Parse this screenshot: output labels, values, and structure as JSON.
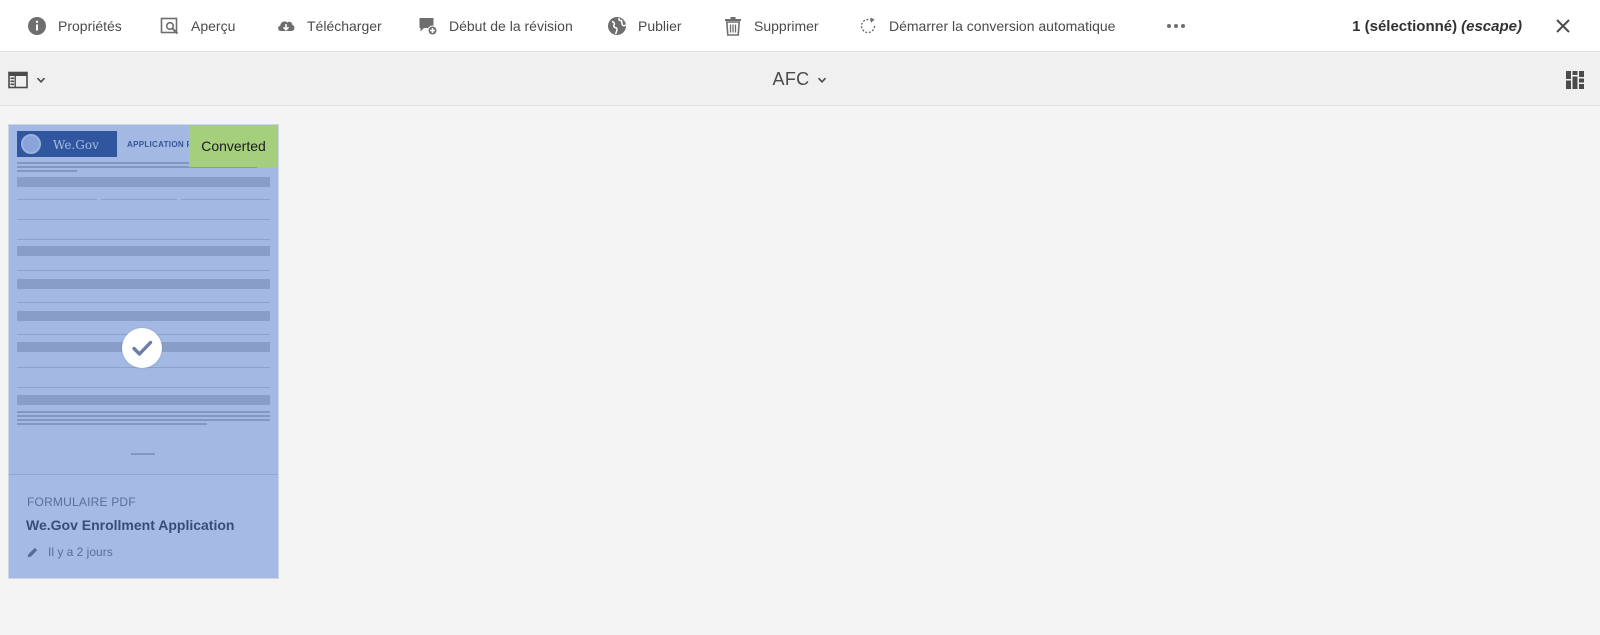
{
  "actionbar": {
    "actions": [
      {
        "id": "properties",
        "label": "Propriétés",
        "icon": "info-icon"
      },
      {
        "id": "preview",
        "label": "Aperçu",
        "icon": "preview-icon"
      },
      {
        "id": "download",
        "label": "Télécharger",
        "icon": "cloud-download-icon"
      },
      {
        "id": "review",
        "label": "Début de la révision",
        "icon": "start-review-icon"
      },
      {
        "id": "publish",
        "label": "Publier",
        "icon": "globe-icon"
      },
      {
        "id": "delete",
        "label": "Supprimer",
        "icon": "trash-icon"
      },
      {
        "id": "autoconvert",
        "label": "Démarrer la conversion automatique",
        "icon": "refresh-icon"
      }
    ],
    "more_icon": "more-icon",
    "selection_count": "1 (sélectionné)",
    "selection_hint": "(escape)",
    "close_icon": "close-icon"
  },
  "subbar": {
    "rail_icon": "rail-toggle-icon",
    "title": "AFC",
    "view_icon": "card-view-icon"
  },
  "card": {
    "badge": "Converted",
    "selected": true,
    "thumbnail": {
      "brand": "We.Gov",
      "heading": "APPLICATION FOR"
    },
    "type": "Formulaire PDF",
    "title": "We.Gov Enrollment Application",
    "modified": "Il y a 2 jours",
    "modified_icon": "pencil-icon",
    "check_icon": "checkmark-icon"
  },
  "colors": {
    "selection_overlay": "#4270c8",
    "badge": "#a6cf7d",
    "background": "#f4f4f4"
  }
}
